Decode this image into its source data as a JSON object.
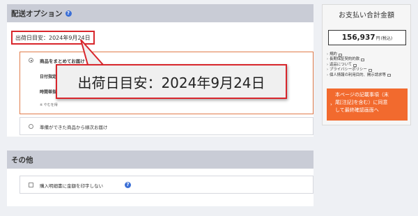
{
  "delivery": {
    "header": "配送オプション",
    "ship_date": "出荷日目安：2024年9月24日",
    "option_bundle": {
      "label": "商品をまとめてお届け",
      "date_label": "日付指定",
      "time_label": "時間帯指定",
      "note": "※ やむを得"
    },
    "option_separate": {
      "label": "準備ができた商品から順次お届け"
    },
    "callout": "出荷日目安：2024年9月24日"
  },
  "other": {
    "header": "その他",
    "checkbox_label": "購入明細書に金額を印字しない"
  },
  "summary": {
    "title": "お支払い合計金額",
    "total": "156,937",
    "unit": "円",
    "tax": "(税込)",
    "links": [
      "規約",
      "長期保証契約約款",
      "返品について",
      "プライバシーポリシー",
      "個人情報の利用目的、開示請求等"
    ],
    "confirm_lines": [
      "本ページの記載事項（末",
      "尾[注記]を含む）に同意",
      "して最終確認画面へ"
    ]
  },
  "colors": {
    "accent_red": "#d8262c",
    "button_orange": "#f26a2e",
    "header_gray": "#c9ccd6",
    "option_border": "#e07b4a"
  }
}
